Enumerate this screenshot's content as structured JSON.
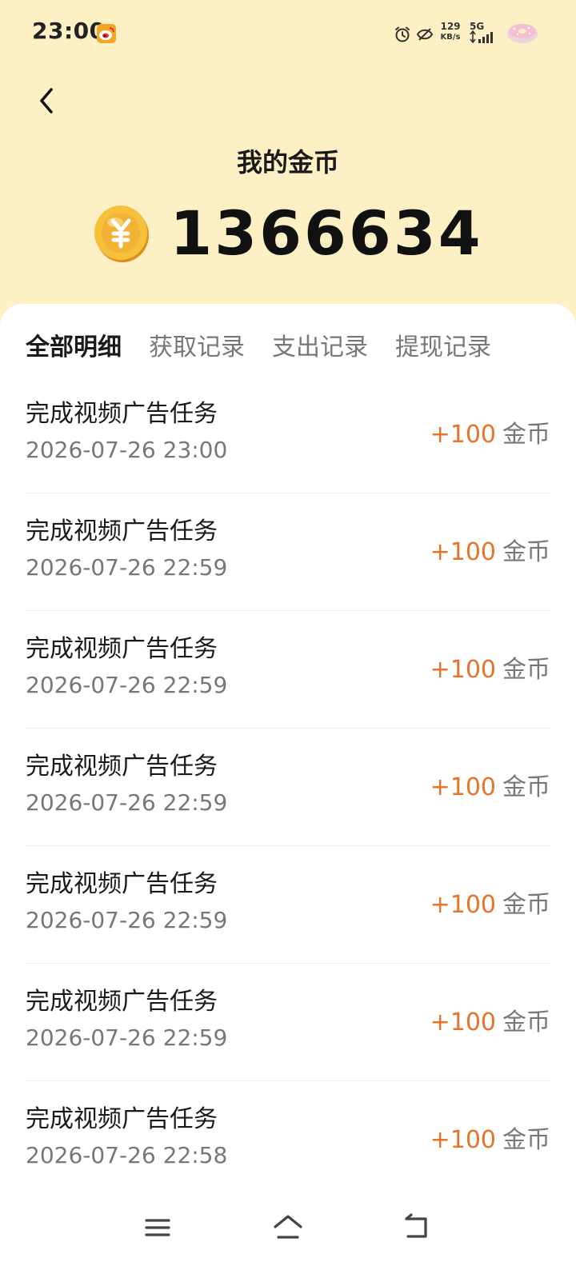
{
  "status_bar": {
    "time": "23:00",
    "speed_value": "129",
    "speed_unit": "KB/s",
    "network": "5G"
  },
  "header": {
    "title": "我的金币",
    "balance": "1366634"
  },
  "tabs": [
    {
      "label": "全部明细",
      "active": true
    },
    {
      "label": "获取记录",
      "active": false
    },
    {
      "label": "支出记录",
      "active": false
    },
    {
      "label": "提现记录",
      "active": false
    }
  ],
  "records": [
    {
      "title": "完成视频广告任务",
      "time": "2026-07-26 23:00",
      "amount": "+100",
      "unit": "金币"
    },
    {
      "title": "完成视频广告任务",
      "time": "2026-07-26 22:59",
      "amount": "+100",
      "unit": "金币"
    },
    {
      "title": "完成视频广告任务",
      "time": "2026-07-26 22:59",
      "amount": "+100",
      "unit": "金币"
    },
    {
      "title": "完成视频广告任务",
      "time": "2026-07-26 22:59",
      "amount": "+100",
      "unit": "金币"
    },
    {
      "title": "完成视频广告任务",
      "time": "2026-07-26 22:59",
      "amount": "+100",
      "unit": "金币"
    },
    {
      "title": "完成视频广告任务",
      "time": "2026-07-26 22:59",
      "amount": "+100",
      "unit": "金币"
    },
    {
      "title": "完成视频广告任务",
      "time": "2026-07-26 22:58",
      "amount": "+100",
      "unit": "金币"
    }
  ],
  "icons": {
    "back": "chevron-left-icon",
    "coin": "coin-icon",
    "nav_menu": "menu-icon",
    "nav_home": "home-icon",
    "nav_back": "back-icon"
  },
  "colors": {
    "header_bg": "#fdf0c4",
    "accent": "#e8732a",
    "coin": "#f2b233"
  }
}
